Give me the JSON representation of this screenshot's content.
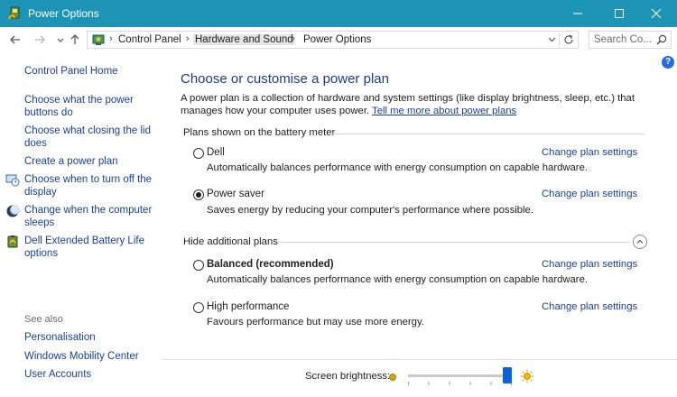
{
  "window": {
    "title": "Power Options",
    "icon": "power-options-icon",
    "controls": [
      "minimize-icon",
      "maximize-icon",
      "close-icon"
    ],
    "accent_color": "#1d93b5"
  },
  "address_bar": {
    "breadcrumbs": [
      "Control Panel",
      "Hardware and Sound",
      "Power Options"
    ],
    "highlighted_crumb": "Hardware and Sound",
    "search_placeholder": "Search Co..."
  },
  "sidebar": {
    "home": "Control Panel Home",
    "links": [
      {
        "label": "Choose what the power buttons do",
        "icon": null
      },
      {
        "label": "Choose what closing the lid does",
        "icon": null
      },
      {
        "label": "Create a power plan",
        "icon": null
      },
      {
        "label": "Choose when to turn off the display",
        "icon": "monitor-clock-icon"
      },
      {
        "label": "Change when the computer sleeps",
        "icon": "moon-icon"
      },
      {
        "label": "Dell Extended Battery Life options",
        "icon": "battery-shield-icon"
      }
    ],
    "see_also_heading": "See also",
    "see_also": [
      "Personalisation",
      "Windows Mobility Center",
      "User Accounts"
    ]
  },
  "main": {
    "heading": "Choose or customise a power plan",
    "intro": "A power plan is a collection of hardware and system settings (like display brightness, sleep, etc.) that manages how your computer uses power.",
    "intro_link": "Tell me more about power plans",
    "battery_meter_label": "Plans shown on the battery meter",
    "hidden_plans_label": "Hide additional plans",
    "change_label": "Change plan settings",
    "plans": [
      {
        "name": "Dell",
        "description": "Automatically balances performance with energy consumption on capable hardware.",
        "selected": false,
        "bold": false
      },
      {
        "name": "Power saver",
        "description": "Saves energy by reducing your computer's performance where possible.",
        "selected": true,
        "bold": false
      },
      {
        "name": "Balanced (recommended)",
        "description": "Automatically balances performance with energy consumption on capable hardware.",
        "selected": false,
        "bold": true
      },
      {
        "name": "High performance",
        "description": "Favours performance but may use more energy.",
        "selected": false,
        "bold": false
      }
    ]
  },
  "brightness": {
    "label": "Screen brightness:",
    "level": 1.0
  }
}
